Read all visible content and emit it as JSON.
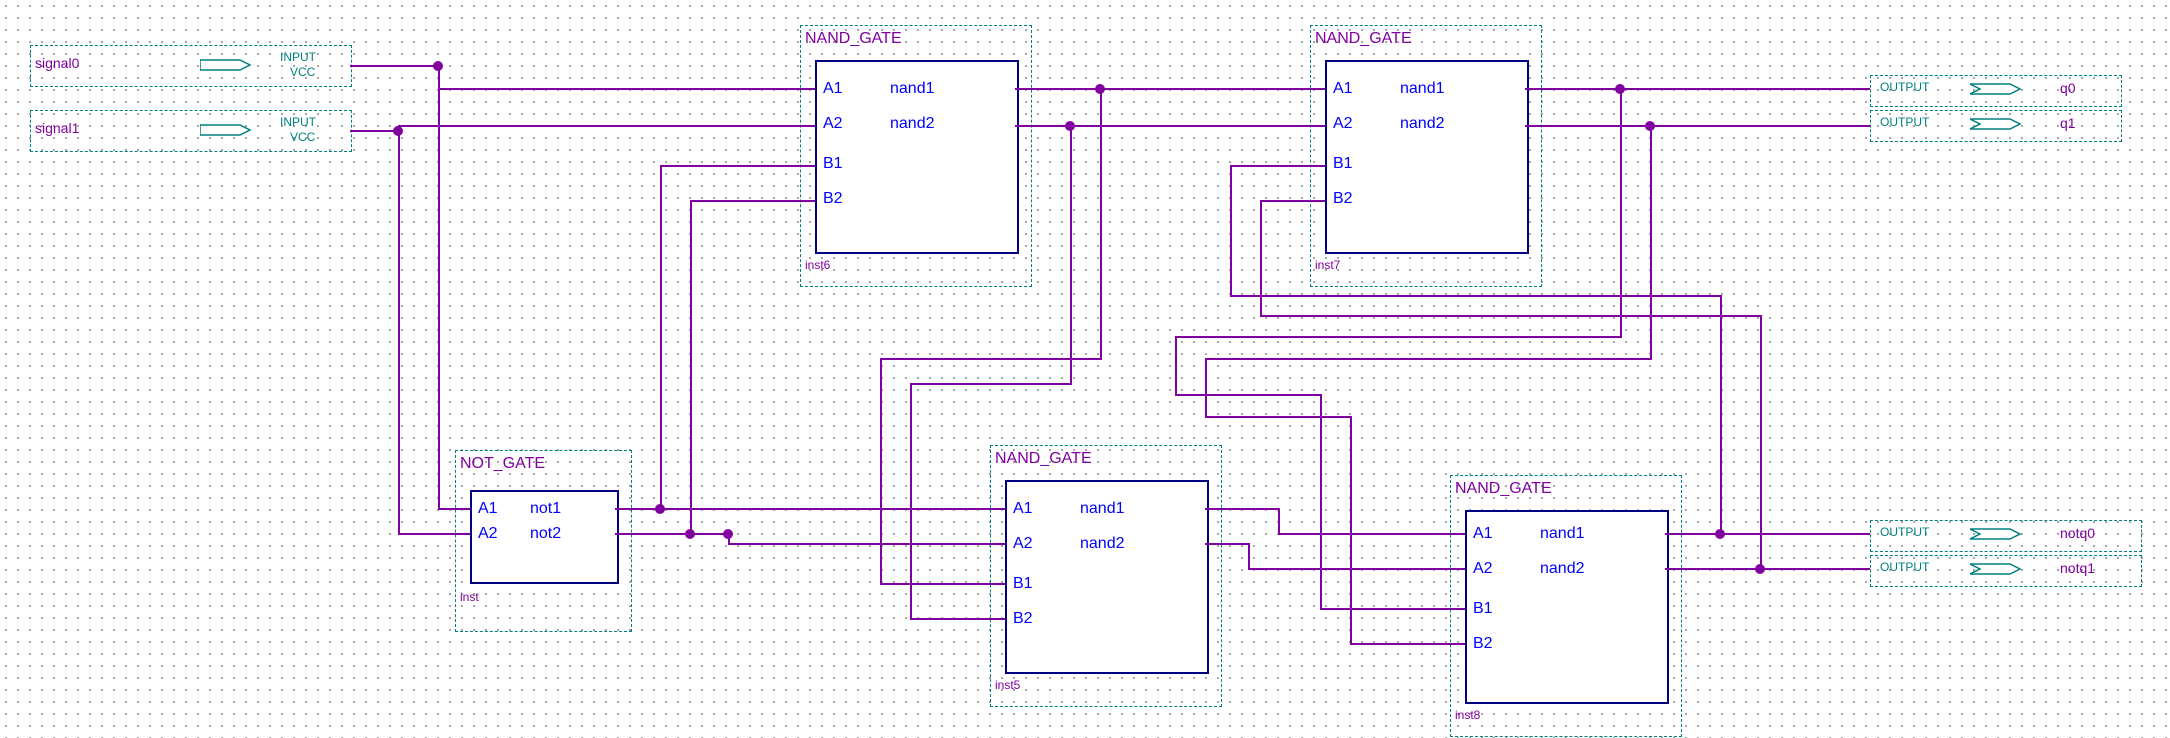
{
  "inputs": {
    "signal0": {
      "label": "signal0",
      "type": "INPUT",
      "vcc": "VCC"
    },
    "signal1": {
      "label": "signal1",
      "type": "INPUT",
      "vcc": "VCC"
    }
  },
  "outputs": {
    "q0": {
      "label": "q0",
      "type": "OUTPUT"
    },
    "q1": {
      "label": "q1",
      "type": "OUTPUT"
    },
    "notq0": {
      "label": "notq0",
      "type": "OUTPUT"
    },
    "notq1": {
      "label": "notq1",
      "type": "OUTPUT"
    }
  },
  "blocks": {
    "notgate": {
      "title": "NOT_GATE",
      "inst": "inst",
      "ports": {
        "a1": "A1",
        "a2": "A2",
        "out1": "not1",
        "out2": "not2"
      }
    },
    "nand_inst6": {
      "title": "NAND_GATE",
      "inst": "inst6",
      "ports": {
        "a1": "A1",
        "a2": "A2",
        "b1": "B1",
        "b2": "B2",
        "out1": "nand1",
        "out2": "nand2"
      }
    },
    "nand_inst7": {
      "title": "NAND_GATE",
      "inst": "inst7",
      "ports": {
        "a1": "A1",
        "a2": "A2",
        "b1": "B1",
        "b2": "B2",
        "out1": "nand1",
        "out2": "nand2"
      }
    },
    "nand_inst5": {
      "title": "NAND_GATE",
      "inst": "inst5",
      "ports": {
        "a1": "A1",
        "a2": "A2",
        "b1": "B1",
        "b2": "B2",
        "out1": "nand1",
        "out2": "nand2"
      }
    },
    "nand_inst8": {
      "title": "NAND_GATE",
      "inst": "inst8",
      "ports": {
        "a1": "A1",
        "a2": "A2",
        "b1": "B1",
        "b2": "B2",
        "out1": "nand1",
        "out2": "nand2"
      }
    }
  }
}
